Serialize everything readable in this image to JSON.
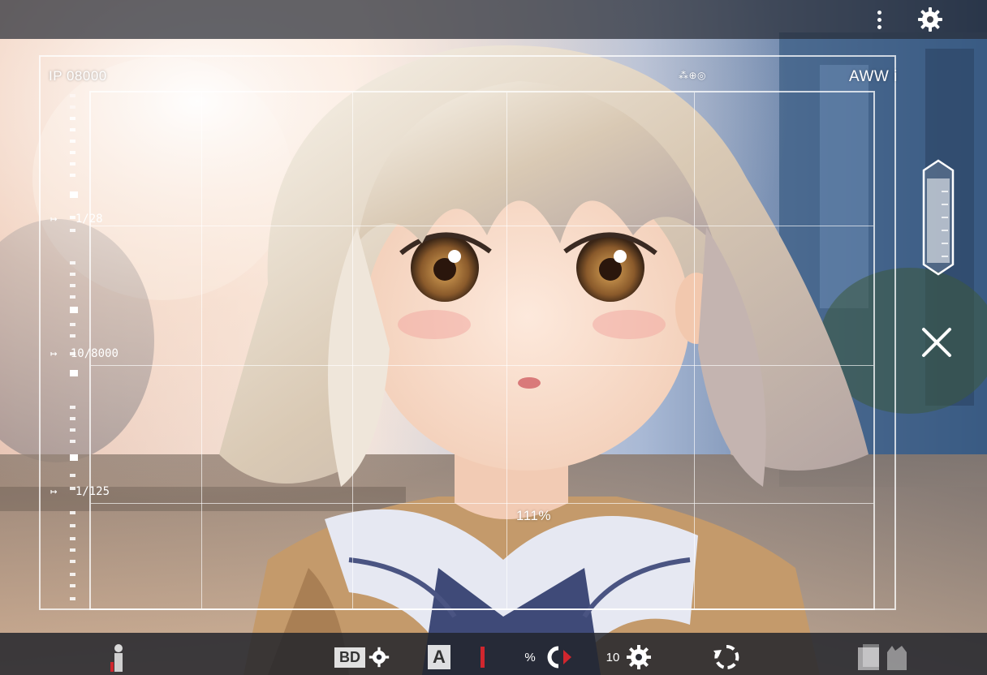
{
  "hud": {
    "top_left_readout": "IP 08000",
    "top_center_readout": "⁂⊕◎",
    "top_right_readout": "AWW i",
    "left_markers": [
      {
        "arrow": "↦",
        "value": "1/28"
      },
      {
        "arrow": "↦",
        "value": "10/8000"
      },
      {
        "arrow": "↦",
        "value": "1/125"
      }
    ],
    "zoom_readout": "111%"
  },
  "bottom_bar": {
    "item_a_label": "BD",
    "item_b_label": "A",
    "item_c_label": "%",
    "item_d_label": "10"
  },
  "colors": {
    "accent_red": "#d0262e",
    "overlay_white": "#ffffff"
  },
  "icons": {
    "menu": "kebab-icon",
    "settings": "gear-icon",
    "close": "close-icon",
    "zoom": "zoom-slider-icon",
    "person": "person-icon",
    "rotate": "rotate-icon",
    "gallery": "gallery-icon"
  }
}
